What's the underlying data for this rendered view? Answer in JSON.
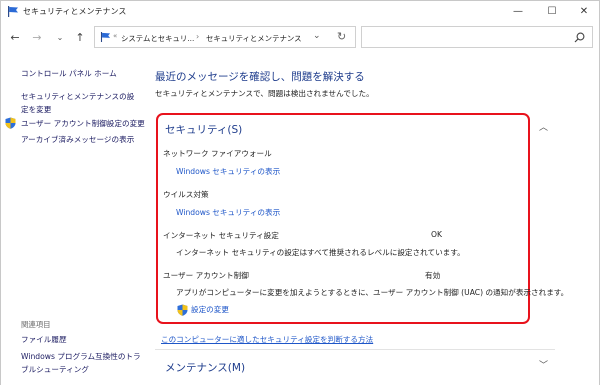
{
  "window": {
    "title": "セキュリティとメンテナンス",
    "minimize_icon": "—",
    "maximize_icon": "☐",
    "close_icon": "✕"
  },
  "nav": {
    "back_icon": "←",
    "forward_icon": "→",
    "recent_icon": "⌄",
    "up_icon": "↑",
    "breadcrumb_sep0": "«",
    "breadcrumb_1": "システムとセキュリ...",
    "breadcrumb_sep1": "›",
    "breadcrumb_2": "セキュリティとメンテナンス",
    "dropdown_icon": "⌄",
    "refresh_icon": "↻",
    "search_value": ""
  },
  "sidebar": {
    "home": "コントロール パネル ホーム",
    "settings": "セキュリティとメンテナンスの設定を変更",
    "uac_settings": "ユーザー アカウント制御設定の変更",
    "archive": "アーカイブ済みメッセージの表示",
    "related_heading": "関連項目",
    "file_history": "ファイル履歴",
    "compat": "Windows プログラム互換性のトラブルシューティング"
  },
  "main": {
    "title": "最近のメッセージを確認し、問題を解決する",
    "subtitle": "セキュリティとメンテナンスで、問題は検出されませんでした。",
    "security": {
      "heading": "セキュリティ(S)",
      "collapse_icon": "︿",
      "firewall_title": "ネットワーク ファイアウォール",
      "firewall_link": "Windows セキュリティの表示",
      "antivirus_title": "ウイルス対策",
      "antivirus_link": "Windows セキュリティの表示",
      "internet_title": "インターネット セキュリティ設定",
      "internet_status": "OK",
      "internet_desc": "インターネット セキュリティの設定はすべて推奨されるレベルに設定されています。",
      "uac_title": "ユーザー アカウント制御",
      "uac_status": "有効",
      "uac_desc": "アプリがコンピューターに変更を加えようとするときに、ユーザー アカウント制御 (UAC) の通知が表示されます。",
      "uac_link": "設定の変更"
    },
    "bottom_link": "このコンピューターに適したセキュリティ設定を判断する方法",
    "maintenance": {
      "heading": "メンテナンス(M)",
      "expand_icon": "﹀"
    }
  },
  "colors": {
    "accent": "#1e3c8c",
    "link": "#1e56c8",
    "highlight_border": "#e8121c"
  }
}
